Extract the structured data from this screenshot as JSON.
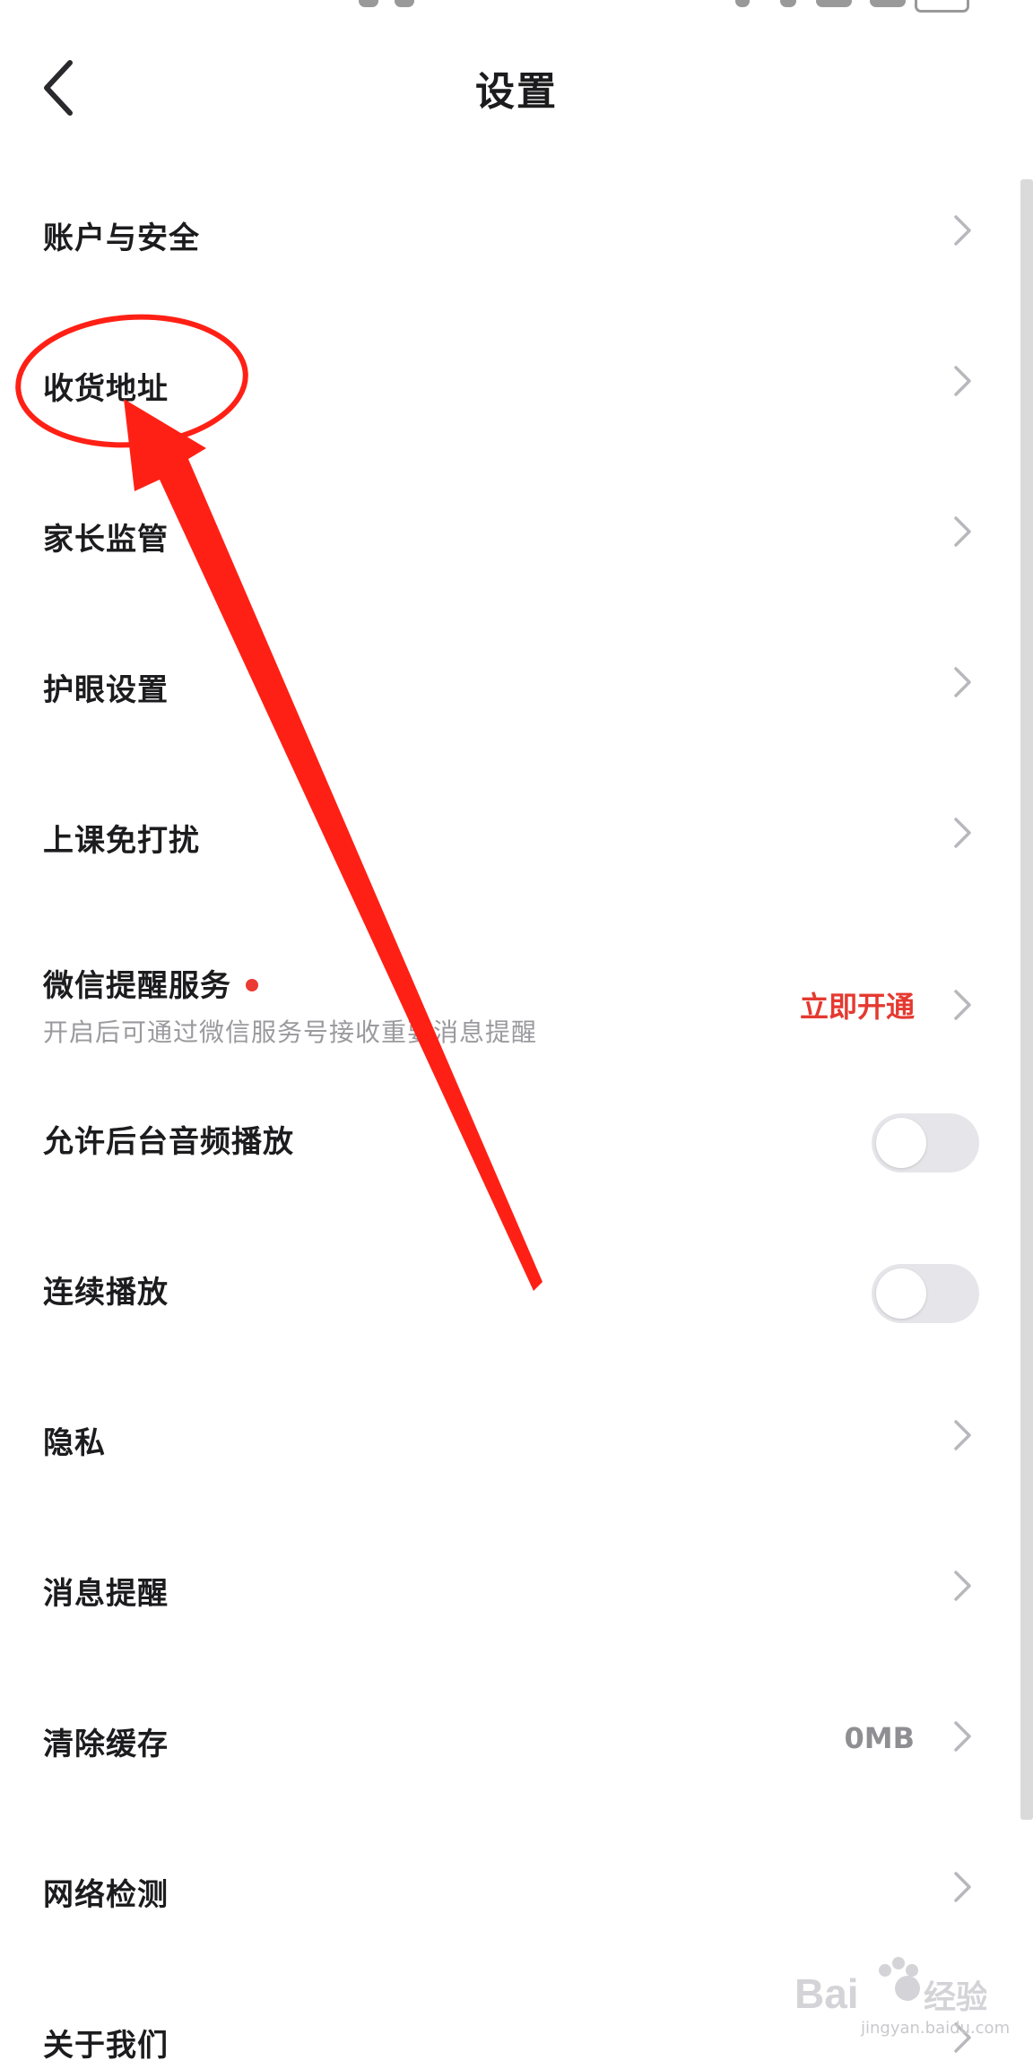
{
  "header": {
    "title": "设置",
    "back_icon": "chevron-left-icon"
  },
  "settings": [
    {
      "label": "账户与安全",
      "type": "link"
    },
    {
      "label": "收货地址",
      "type": "link"
    },
    {
      "label": "家长监管",
      "type": "link"
    },
    {
      "label": "护眼设置",
      "type": "link"
    },
    {
      "label": "上课免打扰",
      "type": "link"
    },
    {
      "label": "微信提醒服务",
      "type": "link",
      "subtitle": "开启后可通过微信服务号接收重要消息提醒",
      "value": "立即开通",
      "badge": "red-dot"
    },
    {
      "label": "允许后台音频播放",
      "type": "toggle",
      "enabled": false
    },
    {
      "label": "连续播放",
      "type": "toggle",
      "enabled": false
    },
    {
      "label": "隐私",
      "type": "link"
    },
    {
      "label": "消息提醒",
      "type": "link"
    },
    {
      "label": "清除缓存",
      "type": "link",
      "value": "0MB"
    },
    {
      "label": "网络检测",
      "type": "link"
    },
    {
      "label": "关于我们",
      "type": "link"
    }
  ],
  "annotation": {
    "highlight_color": "#ff2015",
    "target": "收货地址"
  },
  "watermark": {
    "logo_text": "Bai du 经验",
    "url": "jingyan.baidu.com"
  },
  "colors": {
    "accent": "#e53930",
    "text": "#1c1c1e",
    "secondary": "#9a9a9e",
    "chevron": "#b8b8bc"
  }
}
